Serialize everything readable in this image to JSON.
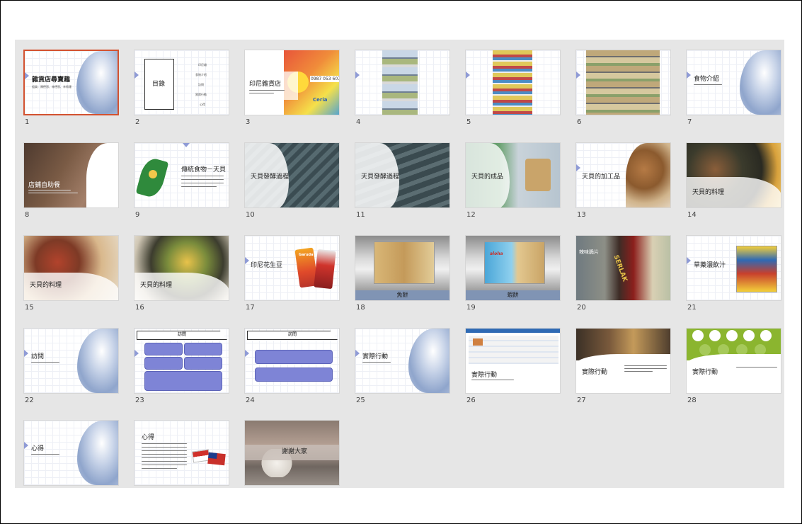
{
  "slides": [
    {
      "n": "1",
      "title": "雜貨店尋寶趣",
      "subtitle": "組員：陳德恩、林德恩、李佩珊"
    },
    {
      "n": "2",
      "title": "目錄",
      "items": [
        "印尼雜",
        "食物介紹",
        "訪問",
        "實際行動",
        "心得"
      ]
    },
    {
      "n": "3",
      "title": "印尼雜貨店",
      "sign": "0987 053 607",
      "brand": "Ceria"
    },
    {
      "n": "4"
    },
    {
      "n": "5"
    },
    {
      "n": "6"
    },
    {
      "n": "7",
      "title": "食物介紹"
    },
    {
      "n": "8",
      "title": "店鋪自助餐"
    },
    {
      "n": "9",
      "title": "傳統食物－天貝"
    },
    {
      "n": "10",
      "title": "天貝發酵過程"
    },
    {
      "n": "11",
      "title": "天貝發酵過程"
    },
    {
      "n": "12",
      "title": "天貝的成品"
    },
    {
      "n": "13",
      "title": "天貝的加工品"
    },
    {
      "n": "14",
      "title": "天貝的料理"
    },
    {
      "n": "15",
      "title": "天貝的料理"
    },
    {
      "n": "16",
      "title": "天貝的料理"
    },
    {
      "n": "17",
      "title": "印尼花生豆",
      "brand": "Garuda"
    },
    {
      "n": "18",
      "caption": "魚餅"
    },
    {
      "n": "19",
      "caption": "蝦餅",
      "brand": "aloha"
    },
    {
      "n": "20",
      "title": "辣味脆片",
      "brand": "SERLAK"
    },
    {
      "n": "21",
      "title": "草藥濃飲汁"
    },
    {
      "n": "22",
      "title": "訪問"
    },
    {
      "n": "23",
      "banner": "訪問"
    },
    {
      "n": "24",
      "banner": "訪問"
    },
    {
      "n": "25",
      "title": "實際行動"
    },
    {
      "n": "26",
      "title": "實際行動"
    },
    {
      "n": "27",
      "title": "實際行動"
    },
    {
      "n": "28",
      "title": "實際行動"
    },
    {
      "n": "29",
      "title": "心得"
    },
    {
      "n": "30",
      "title": "心得"
    },
    {
      "n": "31",
      "title": "謝謝大家"
    }
  ],
  "colors": {
    "selection": "#d35230",
    "background": "#e6e6e6",
    "accent": "#8f9bd6"
  }
}
